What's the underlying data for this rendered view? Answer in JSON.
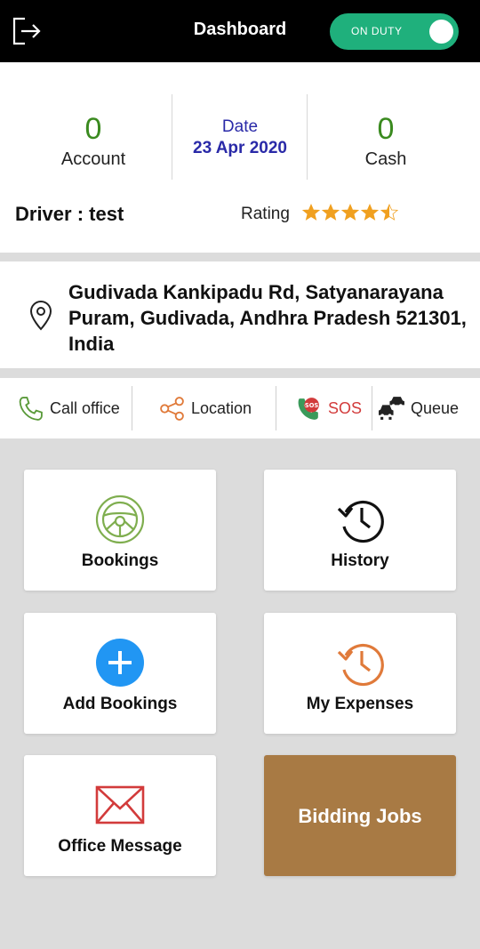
{
  "header": {
    "title": "Dashboard",
    "duty_toggle": "ON DUTY",
    "duty_on": true
  },
  "stats": {
    "account_value": "0",
    "account_label": "Account",
    "date_label": "Date",
    "date_value": "23 Apr 2020",
    "cash_value": "0",
    "cash_label": "Cash"
  },
  "driver": {
    "label": "Driver : test",
    "rating_label": "Rating",
    "rating": 4.5,
    "rating_max": 5,
    "star_color": "#f0a020"
  },
  "address": {
    "text": "Gudivada Kankipadu Rd, Satyanarayana Puram, Gudivada, Andhra Pradesh 521301, India"
  },
  "actions": [
    {
      "label": "Call office",
      "icon": "phone-icon"
    },
    {
      "label": "Location",
      "icon": "share-icon"
    },
    {
      "label": "SOS",
      "icon": "sos-icon"
    },
    {
      "label": "Queue",
      "icon": "cars-icon"
    }
  ],
  "cards": [
    {
      "label": "Bookings",
      "icon": "steering-wheel-icon"
    },
    {
      "label": "History",
      "icon": "history-icon"
    },
    {
      "label": "Add Bookings",
      "icon": "add-icon"
    },
    {
      "label": "My Expenses",
      "icon": "expenses-history-icon"
    },
    {
      "label": "Office Message",
      "icon": "envelope-icon"
    },
    {
      "label": "Bidding Jobs",
      "icon": ""
    }
  ],
  "colors": {
    "accent_green": "#1fb07c",
    "stat_green": "#3a8a1f",
    "date_blue": "#2a2aa8",
    "sos_red": "#d23b3b",
    "bidding_brown": "#a87a44"
  }
}
